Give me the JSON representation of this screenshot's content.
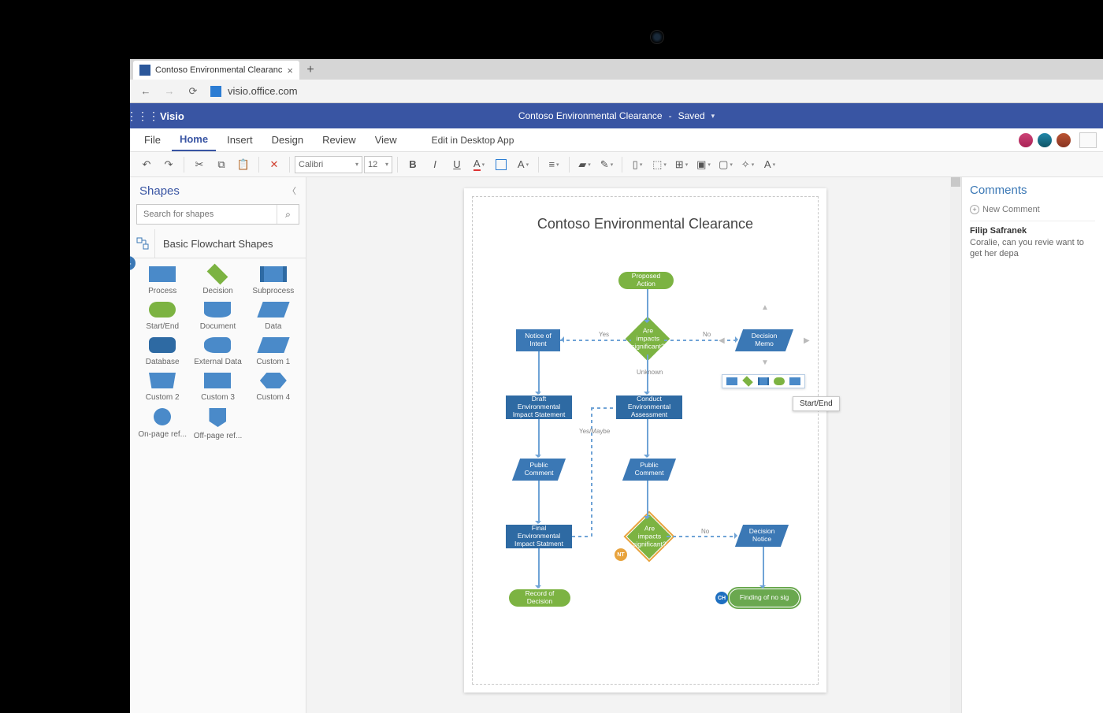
{
  "browser": {
    "tab_title": "Contoso Environmental Clearanc",
    "url": "visio.office.com"
  },
  "app": {
    "name": "Visio",
    "doc_name": "Contoso Environmental Clearance",
    "saved_state": "Saved"
  },
  "ribbon": {
    "tabs": [
      "File",
      "Home",
      "Insert",
      "Design",
      "Review",
      "View"
    ],
    "edit_label": "Edit in Desktop App",
    "font_name": "Calibri",
    "font_size": "12"
  },
  "shapes_panel": {
    "title": "Shapes",
    "search_placeholder": "Search for shapes",
    "category": "Basic Flowchart Shapes",
    "shapes": [
      "Process",
      "Decision",
      "Subprocess",
      "Start/End",
      "Document",
      "Data",
      "Database",
      "External Data",
      "Custom 1",
      "Custom 2",
      "Custom 3",
      "Custom 4",
      "On-page ref...",
      "Off-page ref..."
    ]
  },
  "flowchart": {
    "title": "Contoso Environmental Clearance",
    "nodes": {
      "proposed": "Proposed Action",
      "impacts1": "Are impacts significant?",
      "notice_intent": "Notice of Intent",
      "decision_memo": "Decision Memo",
      "unknown": "Unknown",
      "yes": "Yes",
      "no": "No",
      "no2": "No",
      "yesmaybe": "Yes/Maybe",
      "draft_eis": "Draft Environmental Impact Statement",
      "conduct_ea": "Conduct Environmental Assessment",
      "public_comment1": "Public Comment",
      "public_comment2": "Public Comment",
      "final_eis": "Final Environmental Impact Statment",
      "impacts2": "Are impacts significant?",
      "decision_notice": "Decision Notice",
      "record": "Record of Decision",
      "finding": "Finding of no sig"
    },
    "tooltip": "Start/End",
    "presence": {
      "nt": "NT",
      "ch": "CH"
    }
  },
  "comments": {
    "title": "Comments",
    "new_label": "New Comment",
    "thread": {
      "author": "Filip Safranek",
      "body": "Coralie, can you revie want to get her depa"
    }
  }
}
